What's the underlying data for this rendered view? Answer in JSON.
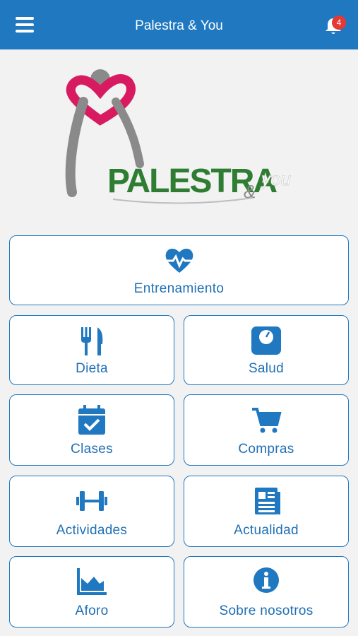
{
  "header": {
    "title": "Palestra & You",
    "notification_count": "4"
  },
  "logo": {
    "word": "PALESTRA",
    "ampersand": "&",
    "suffix": "you"
  },
  "menu": {
    "entrenamiento": "Entrenamiento",
    "dieta": "Dieta",
    "salud": "Salud",
    "clases": "Clases",
    "compras": "Compras",
    "actividades": "Actividades",
    "actualidad": "Actualidad",
    "aforo": "Aforo",
    "sobre_nosotros": "Sobre nosotros"
  },
  "icons": {
    "entrenamiento": "heartbeat-icon",
    "dieta": "fork-knife-icon",
    "salud": "scale-icon",
    "clases": "calendar-check-icon",
    "compras": "shopping-cart-icon",
    "actividades": "dumbbell-icon",
    "actualidad": "newspaper-icon",
    "aforo": "area-chart-icon",
    "sobre_nosotros": "info-icon"
  },
  "colors": {
    "primary": "#1f78c0",
    "badge": "#e53935",
    "logo_pink": "#d81b60",
    "logo_gray": "#8a8a8a"
  }
}
